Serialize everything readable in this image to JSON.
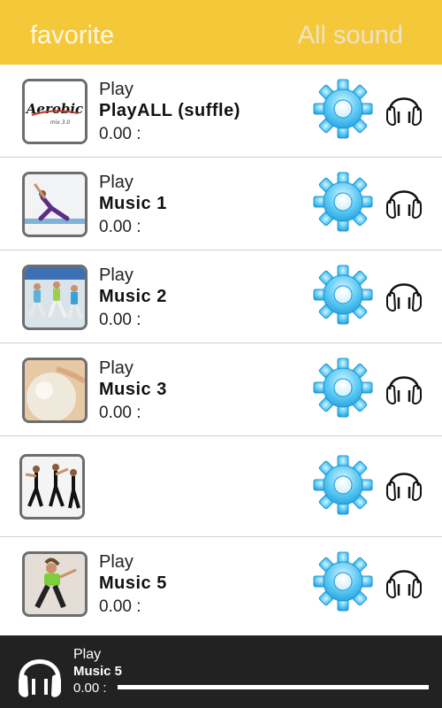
{
  "header": {
    "favorite_label": "favorite",
    "all_sound_label": "All sound",
    "bg_color": "#f5c83a"
  },
  "rows": [
    {
      "play_label": "Play",
      "title": "PlayALL (suffle)",
      "time": "0.00 :",
      "thumb": "Aerobic logo",
      "logo_text": "Aerobic",
      "logo_sub": "mix 3.0"
    },
    {
      "play_label": "Play",
      "title": "Music 1",
      "time": "0.00 :",
      "thumb": "yoga stretch photo"
    },
    {
      "play_label": "Play",
      "title": "Music 2",
      "time": "0.00 :",
      "thumb": "aerobics class photo"
    },
    {
      "play_label": "Play",
      "title": "Music 3",
      "time": "0.00 :",
      "thumb": "exercise ball photo"
    },
    {
      "play_label": "",
      "title": "",
      "time": "",
      "thumb": "dance group photo"
    },
    {
      "play_label": "Play",
      "title": "Music 5",
      "time": "0.00 :",
      "thumb": "dancer photo"
    }
  ],
  "player": {
    "play_label": "Play",
    "title": "Music 5",
    "time": "0.00 :",
    "progress": 0
  },
  "icons": {
    "settings": "gear-icon",
    "listen": "headphones-icon",
    "accent": "#4fc3f0"
  }
}
